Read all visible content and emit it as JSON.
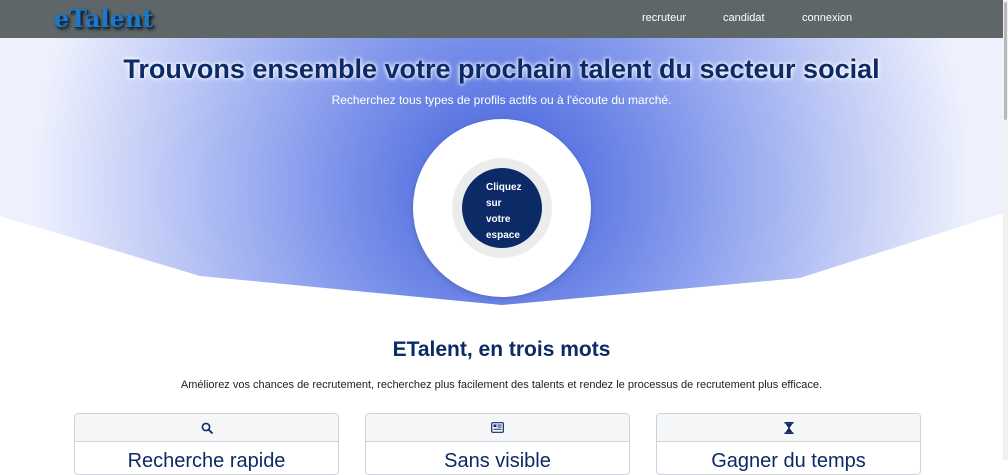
{
  "header": {
    "logo": "eTalent",
    "nav": [
      "recruteur",
      "candidat",
      "connexion"
    ]
  },
  "hero": {
    "title": "Trouvons ensemble votre prochain talent du secteur social",
    "subtitle": "Recherchez tous types de profils actifs ou à l'écoute du marché.",
    "cta_lines": [
      "Cliquez",
      "sur",
      "votre",
      "espace"
    ]
  },
  "section": {
    "title": "ETalent, en trois mots",
    "description": "Améliorez vos chances de recrutement, recherchez plus facilement des talents et rendez le processus de recrutement plus efficace."
  },
  "cards": [
    {
      "icon": "search-icon",
      "title": "Recherche rapide"
    },
    {
      "icon": "newspaper-icon",
      "title": "Sans visible"
    },
    {
      "icon": "hourglass-icon",
      "title": "Gagner du temps"
    }
  ],
  "colors": {
    "navbar": "#5f6668",
    "primary": "#0c2a66",
    "hero_blue": "#4f6fe0",
    "logo": "#1d78c8"
  }
}
